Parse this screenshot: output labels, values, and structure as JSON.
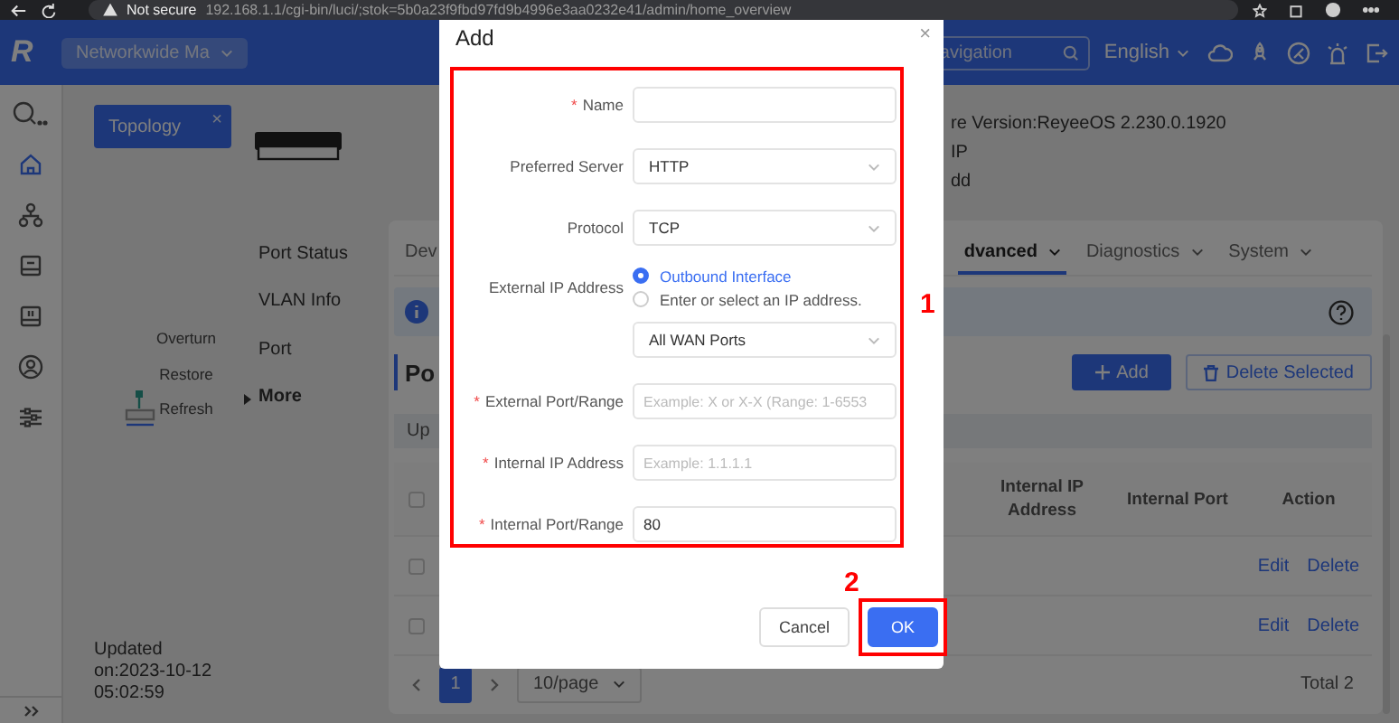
{
  "browser": {
    "security": "Not secure",
    "url": "192.168.1.1/cgi-bin/luci/;stok=5b0a23f9fbd97fd9b4996e3aa0232e41/admin/home_overview"
  },
  "header": {
    "logo": "R",
    "network": "Networkwide Ma",
    "search": {
      "placeholder": "avigation"
    },
    "language": "English"
  },
  "topology": {
    "tab": "Topology",
    "close": "×"
  },
  "device_actions": [
    "Overturn",
    "Restore",
    "Refresh"
  ],
  "device_menu": [
    {
      "label": "Port Status",
      "selected": false
    },
    {
      "label": "VLAN Info",
      "selected": false
    },
    {
      "label": "Port",
      "selected": false
    },
    {
      "label": "More",
      "selected": true
    }
  ],
  "updated": "Updated on:2023-10-12 05:02:59",
  "device_info": [
    "re Version:ReyeeOS 2.230.0.1920",
    "IP",
    "dd"
  ],
  "tabs": [
    {
      "label": "Dev",
      "selected": false,
      "menu": false
    },
    {
      "label": "dvanced",
      "selected": true,
      "menu": true
    },
    {
      "label": "Diagnostics",
      "selected": false,
      "menu": true
    },
    {
      "label": "System",
      "selected": false,
      "menu": true
    }
  ],
  "section": {
    "title": "Po",
    "add": "Add",
    "delete": "Delete Selected",
    "filter": "Up"
  },
  "table": {
    "select_all": false,
    "columns": [
      "Internal IP Address",
      "Internal Port",
      "Action"
    ],
    "rows": [
      {
        "checked": false,
        "actions": [
          "Edit",
          "Delete"
        ]
      },
      {
        "checked": false,
        "actions": [
          "Edit",
          "Delete"
        ]
      }
    ]
  },
  "pagination": {
    "pages": [
      {
        "label": "1",
        "selected": true
      }
    ],
    "page_size": "10/page",
    "total": "Total 2"
  },
  "dialog": {
    "title": "Add",
    "close": "×",
    "required_mark": "*",
    "fields": [
      {
        "kind": "input",
        "label": "Name",
        "required": true
      },
      {
        "kind": "select",
        "label": "Preferred Server",
        "required": false,
        "value": "HTTP"
      },
      {
        "kind": "select",
        "label": "Protocol",
        "required": false,
        "value": "TCP"
      },
      {
        "kind": "radio_select",
        "label": "External IP Address",
        "required": false,
        "options": [
          {
            "label": "Outbound Interface",
            "selected": true
          },
          {
            "label": "Enter or select an IP address.",
            "selected": false
          }
        ],
        "value": "All WAN Ports"
      },
      {
        "kind": "input",
        "label": "External Port/Range",
        "required": true,
        "placeholder": "Example: X or X-X (Range: 1-6553"
      },
      {
        "kind": "input",
        "label": "Internal IP Address",
        "required": true,
        "placeholder": "Example: 1.1.1.1"
      },
      {
        "kind": "input",
        "label": "Internal Port/Range",
        "required": true,
        "value": "80"
      }
    ],
    "buttons": [
      {
        "label": "Cancel",
        "kind": "secondary"
      },
      {
        "label": "OK",
        "kind": "primary"
      }
    ]
  },
  "annotations": {
    "form": "1",
    "ok": "2"
  }
}
